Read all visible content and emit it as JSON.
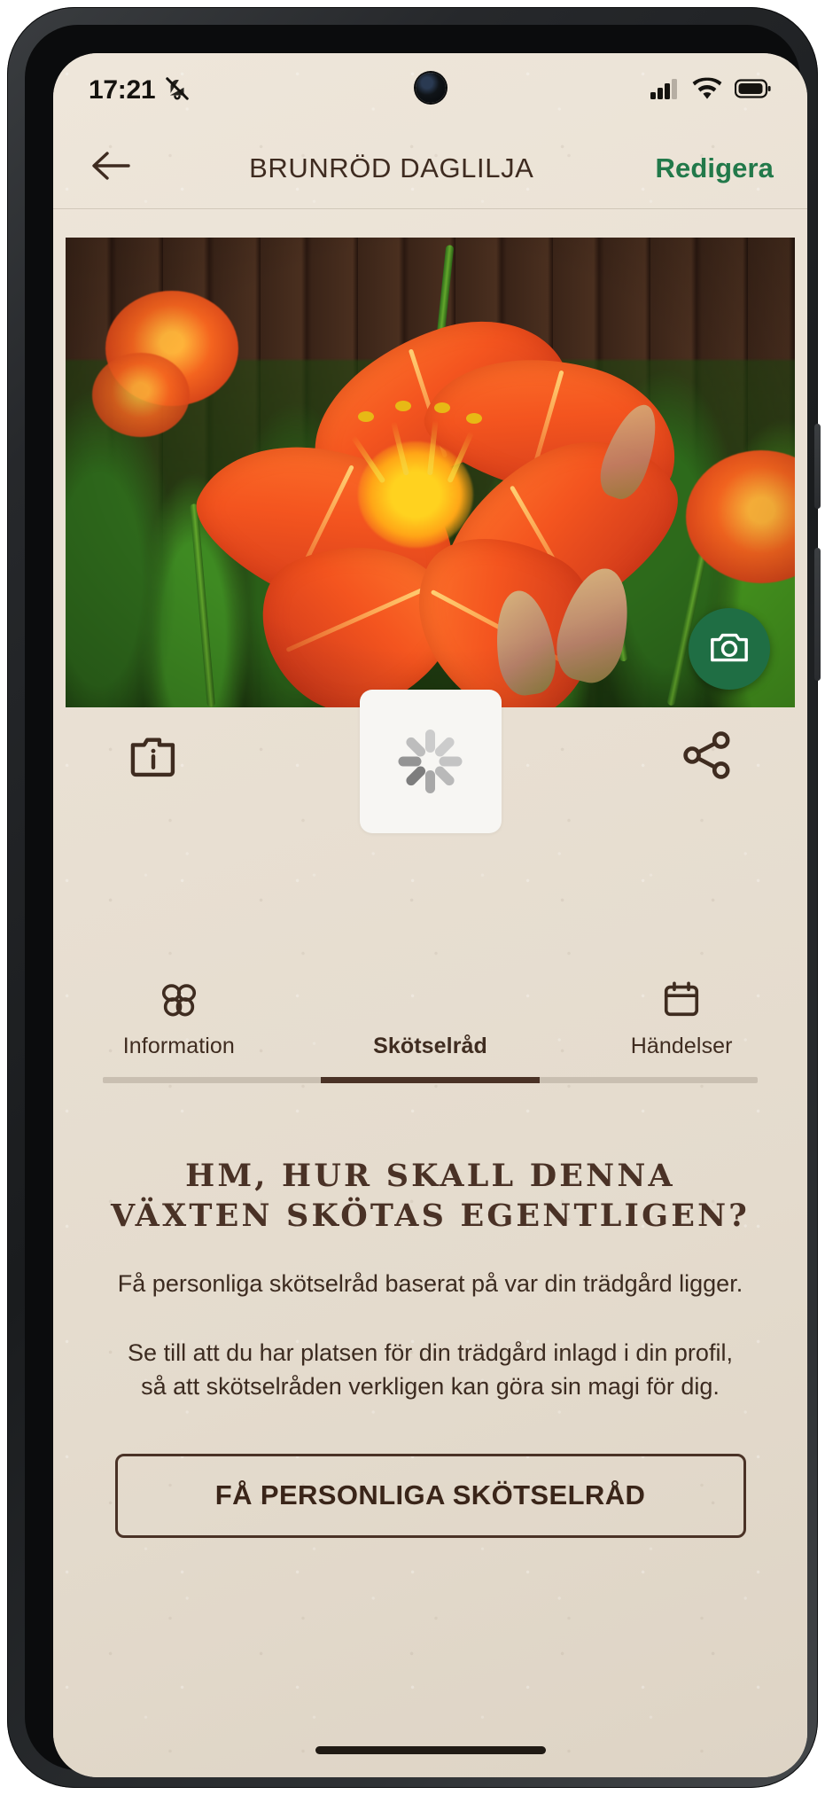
{
  "status_bar": {
    "time": "17:21",
    "icons": {
      "notifications_muted": "bell-slash-icon",
      "signal": "cellular-signal-icon",
      "wifi": "wifi-icon",
      "battery": "battery-icon"
    }
  },
  "nav": {
    "back_icon": "arrow-left-icon",
    "title": "BRUNRÖD DAGLILJA",
    "edit_label": "Redigera",
    "edit_color": "#22794a"
  },
  "hero": {
    "photo_alt": "orange daylily flower",
    "camera_fab_icon": "camera-icon",
    "camera_fab_color": "#1f6e44"
  },
  "actions": {
    "add_photo_icon": "camera-info-icon",
    "share_icon": "share-icon",
    "loading_icon": "loading-spinner-icon"
  },
  "tabs": [
    {
      "label": "Information",
      "icon": "flower-icon",
      "active": false
    },
    {
      "label": "Skötselråd",
      "icon": "leaf-icon",
      "active": true
    },
    {
      "label": "Händelser",
      "icon": "calendar-icon",
      "active": false
    }
  ],
  "content": {
    "heading": "HM, HUR SKALL DENNA VÄXTEN SKÖTAS EGENTLIGEN?",
    "paragraph_1": "Få personliga skötselråd baserat på var din trädgård ligger.",
    "paragraph_2": "Se till att du har platsen för din trädgård inlagd i din profil, så att skötselråden verkligen kan göra sin magi för dig.",
    "cta_label": "FÅ PERSONLIGA SKÖTSELRÅD"
  },
  "theme": {
    "background": "#e9e0d3",
    "text_dark": "#4a3226",
    "accent_green": "#1f6e44"
  }
}
